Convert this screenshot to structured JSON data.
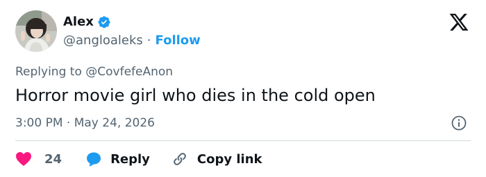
{
  "author": {
    "name": "Alex",
    "handle": "@angloaleks",
    "separator": "·",
    "follow_label": "Follow"
  },
  "tweet": {
    "replying_prefix": "Replying to ",
    "replying_to": "@CovfefeAnon",
    "text": "Horror movie girl who dies in the cold open",
    "time": "3:00 PM",
    "time_separator": " · ",
    "date": "May 24, 2026"
  },
  "actions": {
    "like_count": "24",
    "reply_label": "Reply",
    "copy_label": "Copy link"
  },
  "icons": {
    "brand": "x-logo-icon",
    "verified": "verified-badge-icon",
    "info": "info-icon",
    "like": "heart-icon",
    "reply": "reply-bubble-icon",
    "copy": "link-icon"
  },
  "colors": {
    "accent": "#1d9bf0",
    "like": "#f91880",
    "text": "#0f1419",
    "muted": "#536471",
    "divider": "#cfd9de"
  }
}
